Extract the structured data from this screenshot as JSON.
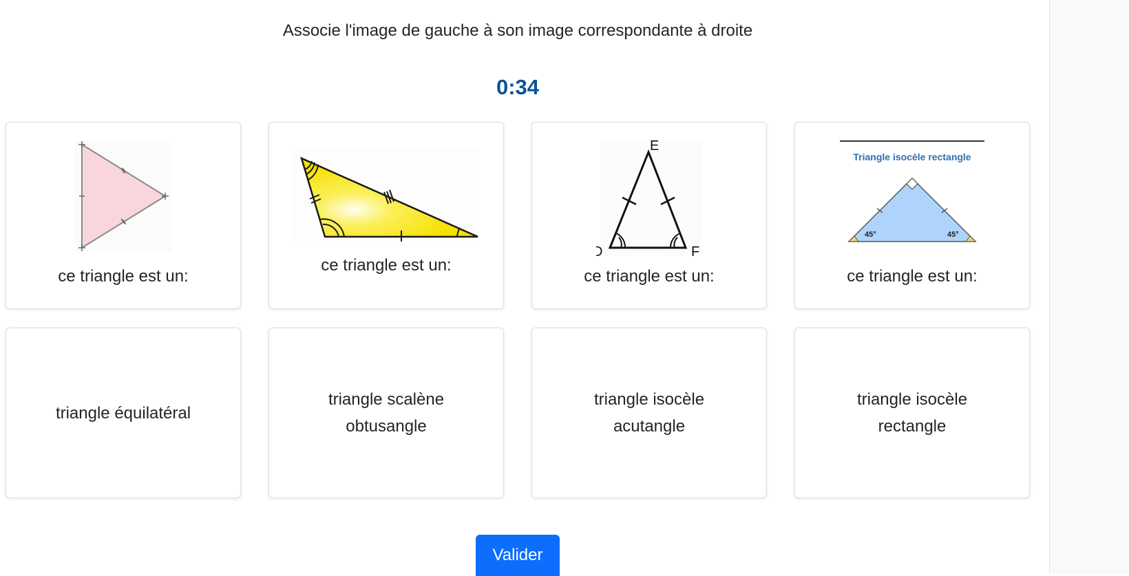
{
  "instruction": "Associe l'image de gauche à son image correspondante à droite",
  "timer": "0:34",
  "questions": [
    {
      "caption": "ce triangle est un:",
      "figure": "pink-equilateral-triangle"
    },
    {
      "caption": "ce triangle est un:",
      "figure": "yellow-scalene-obtuse-triangle"
    },
    {
      "caption": "ce triangle est un:",
      "figure": "isosceles-acute-triangle-def",
      "labels": {
        "top": "E",
        "left": "D",
        "right": "F"
      }
    },
    {
      "caption": "ce triangle est un:",
      "figure": "blue-isosceles-right-triangle",
      "figure_title": "Triangle isocèle rectangle",
      "angle_left": "45°",
      "angle_right": "45°"
    }
  ],
  "answers": [
    {
      "label": "triangle équilatéral"
    },
    {
      "label": "triangle scalène obtusangle"
    },
    {
      "label": "triangle isocèle acutangle"
    },
    {
      "label": "triangle isocèle rectangle"
    }
  ],
  "validate_label": "Valider",
  "colors": {
    "timer": "#0b5394",
    "button": "#0d6efd",
    "pink_fill": "#f9d6dc",
    "yellow_fill": "#f5e000",
    "blue_fill": "#aed4fb",
    "figure_title": "#2f6fb0"
  }
}
